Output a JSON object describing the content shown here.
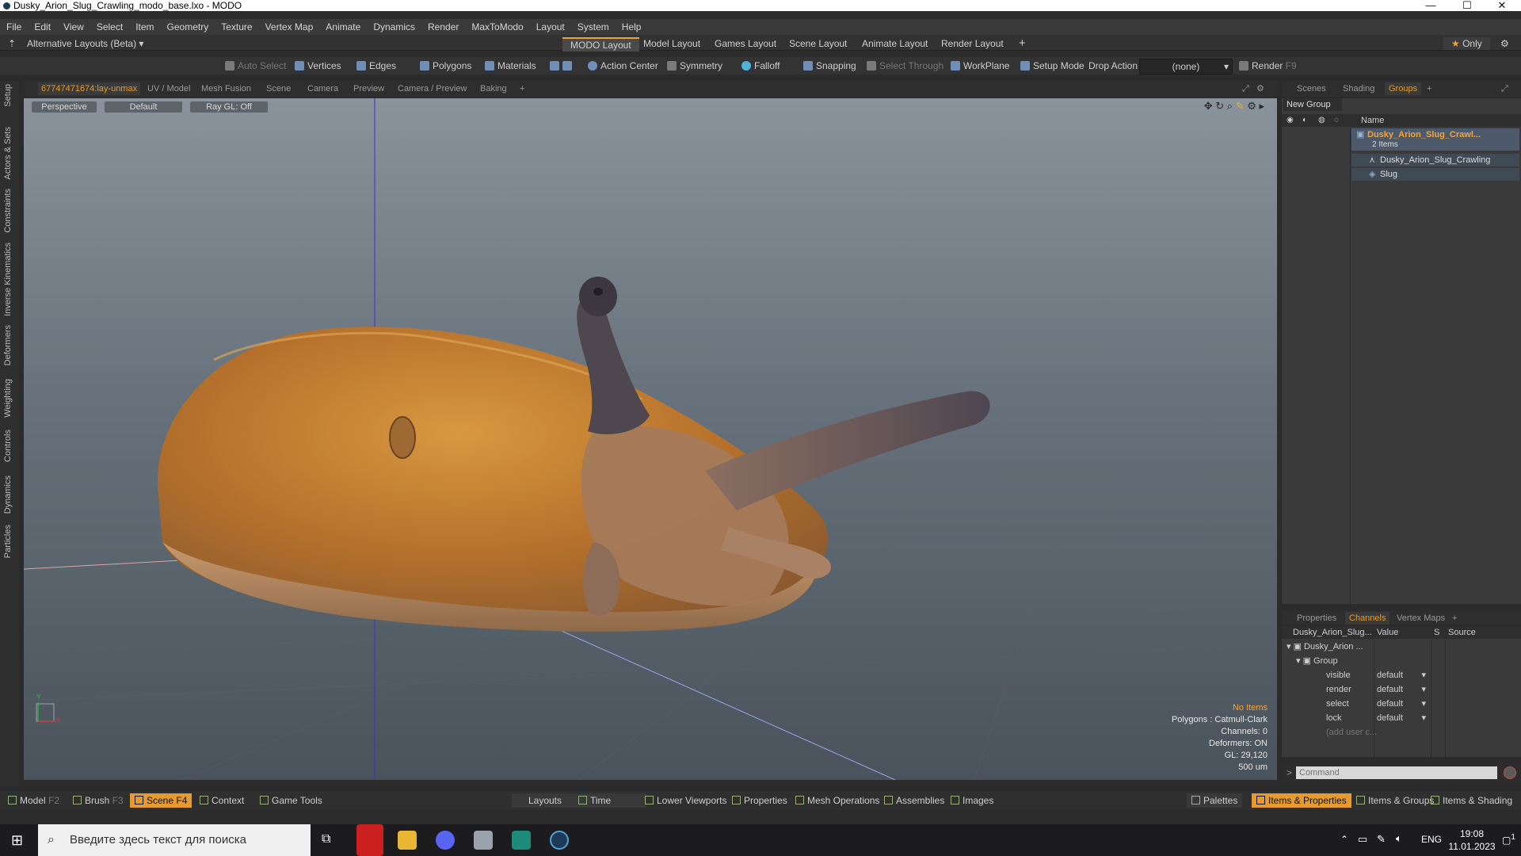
{
  "window": {
    "title": "Dusky_Arion_Slug_Crawling_modo_base.lxo - MODO",
    "minimize": "—",
    "maximize": "☐",
    "close": "✕"
  },
  "menu": [
    "File",
    "Edit",
    "View",
    "Select",
    "Item",
    "Geometry",
    "Texture",
    "Vertex Map",
    "Animate",
    "Dynamics",
    "Render",
    "MaxToModo",
    "Layout",
    "System",
    "Help"
  ],
  "layouts": {
    "alt_label": "Alternative Layouts (Beta)",
    "tabs": [
      "MODO Layout",
      "Model Layout",
      "Games Layout",
      "Scene Layout",
      "Animate Layout",
      "Render Layout"
    ],
    "plus": "+",
    "only": "Only"
  },
  "toolbar": {
    "auto_select": "Auto Select",
    "vertices": "Vertices",
    "edges": "Edges",
    "polygons": "Polygons",
    "materials": "Materials",
    "action_center": "Action Center",
    "symmetry": "Symmetry",
    "falloff": "Falloff",
    "snapping": "Snapping",
    "select_through": "Select Through",
    "workplane": "WorkPlane",
    "setup_mode": "Setup Mode",
    "drop_action": "Drop Action",
    "drop_value": "(none)",
    "render": "Render",
    "render_key": "F9"
  },
  "left_tabs": [
    "Setup",
    "Actors & Sets",
    "Constraints",
    "Inverse Kinematics",
    "Deformers",
    "Weighting",
    "Controls",
    "Dynamics",
    "Particles"
  ],
  "viewport_tabs": [
    "67747471674:lay-unmax",
    "UV / Model",
    "Mesh Fusion",
    "Scene",
    "Camera",
    "Preview",
    "Camera / Preview",
    "Baking",
    "+"
  ],
  "viewport": {
    "view": "Perspective",
    "shading": "Default",
    "raygl": "Ray GL: Off",
    "stats": {
      "items": "No Items",
      "polygons": "Polygons : Catmull-Clark",
      "channels": "Channels: 0",
      "deformers": "Deformers: ON",
      "gl": "GL: 29,120",
      "unit": "500 um"
    },
    "axis_y": "Y",
    "axis_x": "X"
  },
  "right_panel": {
    "top_tabs": [
      "Scenes",
      "Shading",
      "Groups",
      "+"
    ],
    "new_group": "New Group",
    "name_header": "Name",
    "group_name": "Dusky_Arion_Slug_Crawl...",
    "group_count": "2 Items",
    "items": [
      "Dusky_Arion_Slug_Crawling",
      "Slug"
    ]
  },
  "channels_panel": {
    "tabs": [
      "Properties",
      "Channels",
      "Vertex Maps",
      "+"
    ],
    "headers": {
      "name": "Dusky_Arion_Slug...",
      "value": "Value",
      "s": "S",
      "source": "Source"
    },
    "item": "Dusky_Arion ...",
    "group": "Group",
    "rows": [
      {
        "name": "visible",
        "value": "default"
      },
      {
        "name": "render",
        "value": "default"
      },
      {
        "name": "select",
        "value": "default"
      },
      {
        "name": "lock",
        "value": "default"
      }
    ],
    "add_user": "(add user c...",
    "command_placeholder": "Command"
  },
  "bottom_bar": {
    "model": "Model",
    "model_key": "F2",
    "brush": "Brush",
    "brush_key": "F3",
    "scene": "Scene",
    "scene_key": "F4",
    "context": "Context",
    "game_tools": "Game Tools",
    "layouts": "Layouts",
    "time": "Time",
    "lower_viewports": "Lower Viewports",
    "properties": "Properties",
    "mesh_operations": "Mesh Operations",
    "assemblies": "Assemblies",
    "images": "Images",
    "palettes": "Palettes",
    "items_props": "Items & Properties",
    "items_groups": "Items & Groups",
    "items_shading": "Items & Shading"
  },
  "taskbar": {
    "search": "Введите здесь текст для поиска",
    "lang": "ENG",
    "time": "19:08",
    "date": "11.01.2023",
    "notif": "1"
  }
}
